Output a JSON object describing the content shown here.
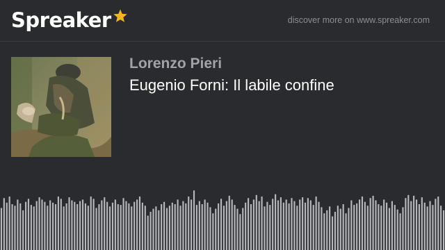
{
  "brand": {
    "name": "Spreaker",
    "accent_color": "#f5b51c",
    "icon": "star-icon"
  },
  "header": {
    "tagline": "discover more on www.spreaker.com"
  },
  "episode": {
    "author": "Lorenzo Pieri",
    "title": "Eugenio Forni: Il labile confine",
    "cover_icon": "podcast-cover-image"
  },
  "waveform": {
    "color": "#b7b8bc",
    "bar_count": 160,
    "levels": [
      0.55,
      0.68,
      0.62,
      0.7,
      0.6,
      0.58,
      0.66,
      0.61,
      0.52,
      0.63,
      0.67,
      0.59,
      0.57,
      0.64,
      0.69,
      0.66,
      0.63,
      0.58,
      0.65,
      0.62,
      0.6,
      0.7,
      0.67,
      0.57,
      0.61,
      0.69,
      0.65,
      0.63,
      0.6,
      0.64,
      0.66,
      0.61,
      0.58,
      0.7,
      0.67,
      0.55,
      0.6,
      0.65,
      0.69,
      0.63,
      0.57,
      0.62,
      0.66,
      0.6,
      0.59,
      0.68,
      0.64,
      0.61,
      0.57,
      0.63,
      0.66,
      0.7,
      0.62,
      0.58,
      0.45,
      0.5,
      0.54,
      0.57,
      0.52,
      0.6,
      0.63,
      0.55,
      0.58,
      0.62,
      0.6,
      0.66,
      0.58,
      0.64,
      0.61,
      0.7,
      0.66,
      0.78,
      0.59,
      0.64,
      0.6,
      0.66,
      0.62,
      0.56,
      0.48,
      0.54,
      0.61,
      0.67,
      0.58,
      0.64,
      0.71,
      0.66,
      0.59,
      0.54,
      0.47,
      0.55,
      0.62,
      0.68,
      0.6,
      0.66,
      0.72,
      0.64,
      0.7,
      0.57,
      0.63,
      0.59,
      0.67,
      0.73,
      0.65,
      0.69,
      0.62,
      0.66,
      0.61,
      0.68,
      0.64,
      0.58,
      0.66,
      0.69,
      0.62,
      0.68,
      0.65,
      0.59,
      0.7,
      0.63,
      0.56,
      0.48,
      0.52,
      0.57,
      0.44,
      0.5,
      0.58,
      0.54,
      0.6,
      0.48,
      0.55,
      0.65,
      0.59,
      0.61,
      0.66,
      0.7,
      0.63,
      0.58,
      0.68,
      0.71,
      0.65,
      0.6,
      0.58,
      0.66,
      0.62,
      0.55,
      0.64,
      0.59,
      0.53,
      0.48,
      0.56,
      0.68,
      0.72,
      0.64,
      0.71,
      0.66,
      0.6,
      0.69,
      0.62,
      0.57,
      0.64,
      0.59,
      0.67,
      0.7,
      0.58,
      0.52
    ]
  }
}
